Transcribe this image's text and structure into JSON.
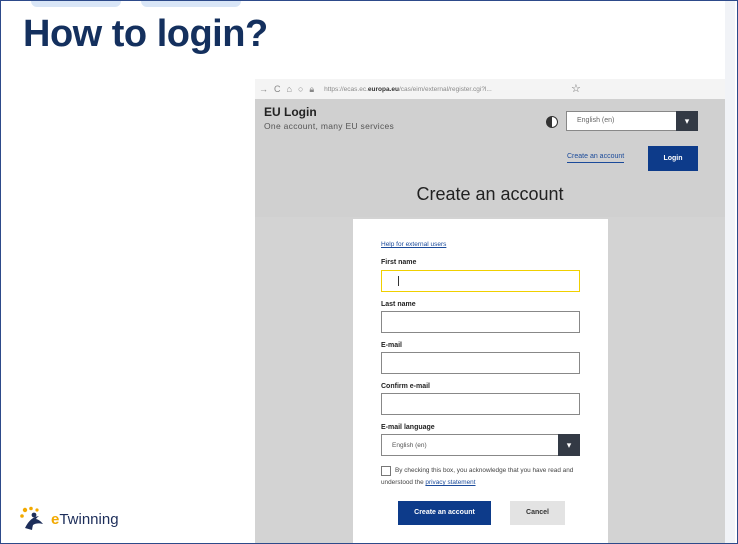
{
  "slide": {
    "title": "How to login?",
    "logo_e": "e",
    "logo_text": "Twinning"
  },
  "browser": {
    "nav_icons": [
      "back-arrow-icon",
      "reload-icon",
      "home-icon",
      "shield-icon",
      "lock-icon"
    ],
    "url_prefix": "https://ecas.ec.",
    "url_domain": "europa.eu",
    "url_rest": "/cas/eim/external/register.cgi?l..."
  },
  "eu_login": {
    "title": "EU Login",
    "subtitle": "One account, many EU services",
    "language_selected": "English (en)",
    "create_link": "Create an account",
    "login_button": "Login",
    "page_title": "Create an account"
  },
  "form": {
    "help_link": "Help for external users",
    "first_name_label": "First name",
    "last_name_label": "Last name",
    "email_label": "E-mail",
    "confirm_email_label": "Confirm e-mail",
    "email_language_label": "E-mail language",
    "email_language_value": "English (en)",
    "consent_text": "By checking this box, you acknowledge that you have read and understood the",
    "consent_link": "privacy statement",
    "create_button": "Create an account",
    "cancel_button": "Cancel"
  },
  "colors": {
    "title": "#14305e",
    "primary_button": "#0d3b8a",
    "focus_border": "#f0d000",
    "logo_accent": "#f2a900"
  }
}
